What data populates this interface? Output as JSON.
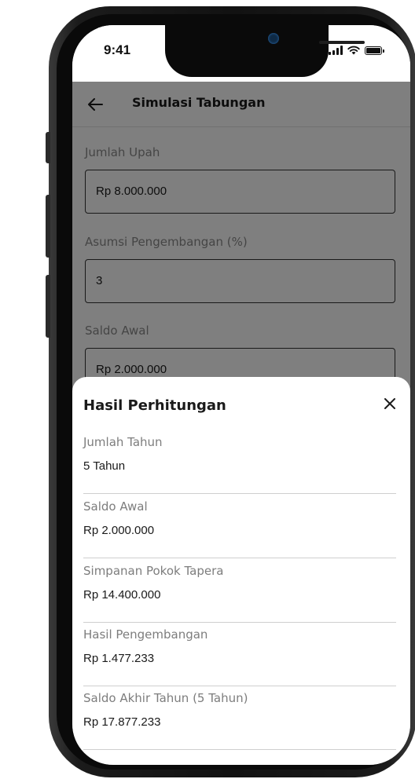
{
  "status_bar": {
    "time": "9:41"
  },
  "header": {
    "title": "Simulasi Tabungan",
    "back_icon": "arrow-left-icon"
  },
  "form": {
    "fields": [
      {
        "label": "Jumlah Upah",
        "value": "Rp 8.000.000"
      },
      {
        "label": "Asumsi Pengembangan (%)",
        "value": "3"
      },
      {
        "label": "Saldo Awal",
        "value": "Rp 2.000.000"
      }
    ]
  },
  "result_sheet": {
    "title": "Hasil Perhitungan",
    "close_icon": "close-icon",
    "items": [
      {
        "label": "Jumlah Tahun",
        "value": "5 Tahun"
      },
      {
        "label": "Saldo Awal",
        "value": "Rp 2.000.000"
      },
      {
        "label": "Simpanan Pokok Tapera",
        "value": "Rp 14.400.000"
      },
      {
        "label": "Hasil Pengembangan",
        "value": "Rp 1.477.233"
      },
      {
        "label": "Saldo Akhir Tahun (5 Tahun)",
        "value": "Rp 17.877.233"
      }
    ]
  },
  "colors": {
    "scrim": "#000000",
    "sheet": "#ffffff",
    "divider": "#cfcfcf",
    "label": "#7d7d7d"
  }
}
